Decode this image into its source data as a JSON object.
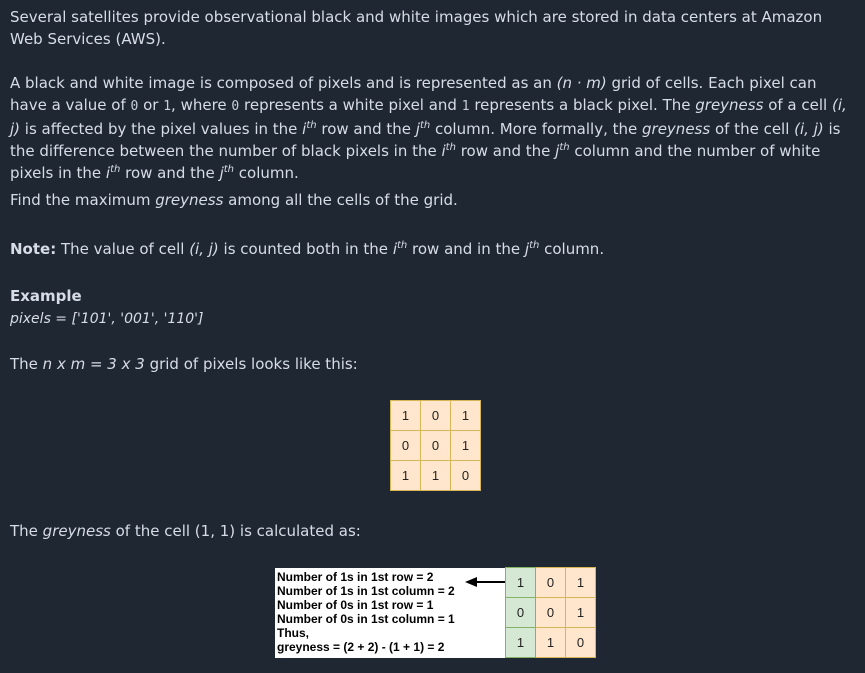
{
  "para1": "Several satellites provide observational black and white images which are stored in data centers at Amazon Web Services (AWS).",
  "para2": {
    "a": "A black and white image is composed of pixels and is represented as an ",
    "grid_dims": "(n · m)",
    "b": " grid of cells. Each pixel can have a value of ",
    "zero": "0",
    "c": " or ",
    "one": "1",
    "d": ", where ",
    "e": " represents a white pixel and ",
    "f": " represents a black pixel. The ",
    "greyness": "greyness",
    "g": " of a cell ",
    "cell": "(i, j)",
    "h": " is affected by the pixel values in the ",
    "i_sym": "i",
    "th": "th",
    "j": " row and the ",
    "j_sym": "j",
    "k": " column. More formally, the ",
    "l": " of the cell ",
    "m": " is the difference between the number of black pixels in the ",
    "n": " row and the ",
    "o": " column and the number of white pixels in the ",
    "p": " row and the ",
    "q": " column."
  },
  "para3": {
    "a": "Find the maximum ",
    "greyness": "greyness",
    "b": " among all the cells of the grid."
  },
  "note": {
    "label": "Note:",
    "a": " The value of cell ",
    "cell": "(i, j)",
    "b": " is counted both in the ",
    "i_sym": "i",
    "th": "th",
    "c": " row and in the ",
    "j_sym": "j",
    "d": " column."
  },
  "example": {
    "heading": "Example",
    "pixels": "pixels = ['101', '001', '110']",
    "grid_intro_a": "The ",
    "grid_intro_dims": "n x m = 3 x 3",
    "grid_intro_b": " grid of pixels looks like this:",
    "grid": [
      [
        "1",
        "0",
        "1"
      ],
      [
        "0",
        "0",
        "1"
      ],
      [
        "1",
        "1",
        "0"
      ]
    ],
    "greyness_intro_a": "The ",
    "greyness_word": "greyness",
    "greyness_intro_b": " of the cell (1, 1) is calculated as:",
    "calc_lines": [
      "Number of 1s in 1st row = 2",
      "Number of 1s in 1st column = 2",
      "Number of 0s in 1st row = 1",
      "Number of 0s in 1st column = 1",
      "Thus,",
      "greyness = (2 + 2) - (1 + 1) = 2"
    ]
  },
  "colors": {
    "background": "#1f2733",
    "cell_orange": "#ffe6cc",
    "cell_green": "#d5e8d4"
  }
}
